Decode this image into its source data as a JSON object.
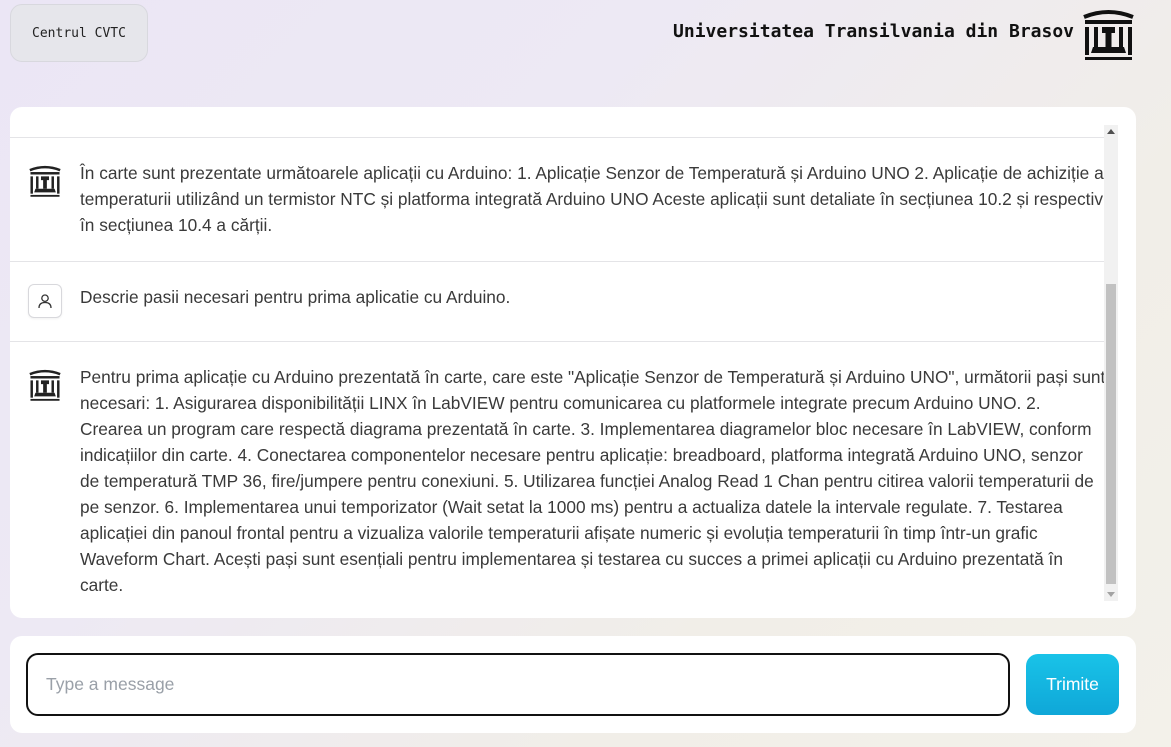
{
  "header": {
    "center_button_label": "Centrul CVTC",
    "university_title": "Universitatea Transilvania din Brasov",
    "logo_icon": "university-pillars-icon"
  },
  "chat": {
    "messages": [
      {
        "role": "assistant",
        "icon": "university-pillars-icon",
        "text": "În carte sunt prezentate următoarele aplicații cu Arduino: 1. Aplicație Senzor de Temperatură și Arduino UNO 2. Aplicație de achiziție a temperaturii utilizând un termistor NTC și platforma integrată Arduino UNO Aceste aplicații sunt detaliate în secțiunea 10.2 și respectiv în secțiunea 10.4 a cărții."
      },
      {
        "role": "user",
        "icon": "user-icon",
        "text": "Descrie pasii necesari pentru prima aplicatie cu Arduino."
      },
      {
        "role": "assistant",
        "icon": "university-pillars-icon",
        "text": "Pentru prima aplicație cu Arduino prezentată în carte, care este \"Aplicație Senzor de Temperatură și Arduino UNO\", următorii pași sunt necesari: 1. Asigurarea disponibilității LINX în LabVIEW pentru comunicarea cu platformele integrate precum Arduino UNO. 2. Crearea un program care respectă diagrama prezentată în carte. 3. Implementarea diagramelor bloc necesare în LabVIEW, conform indicațiilor din carte. 4. Conectarea componentelor necesare pentru aplicație: breadboard, platforma integrată Arduino UNO, senzor de temperatură TMP 36, fire/jumpere pentru conexiuni. 5. Utilizarea funcției Analog Read 1 Chan pentru citirea valorii temperaturii de pe senzor. 6. Implementarea unui temporizator (Wait setat la 1000 ms) pentru a actualiza datele la intervale regulate. 7. Testarea aplicației din panoul frontal pentru a vizualiza valorile temperaturii afișate numeric și evoluția temperaturii în timp într-un grafic Waveform Chart. Acești pași sunt esențiali pentru implementarea și testarea cu succes a primei aplicații cu Arduino prezentată în carte."
      }
    ]
  },
  "composer": {
    "placeholder": "Type a message",
    "value": "",
    "send_label": "Trimite"
  },
  "colors": {
    "send_button": "#13b5e0",
    "input_border": "#111111"
  }
}
